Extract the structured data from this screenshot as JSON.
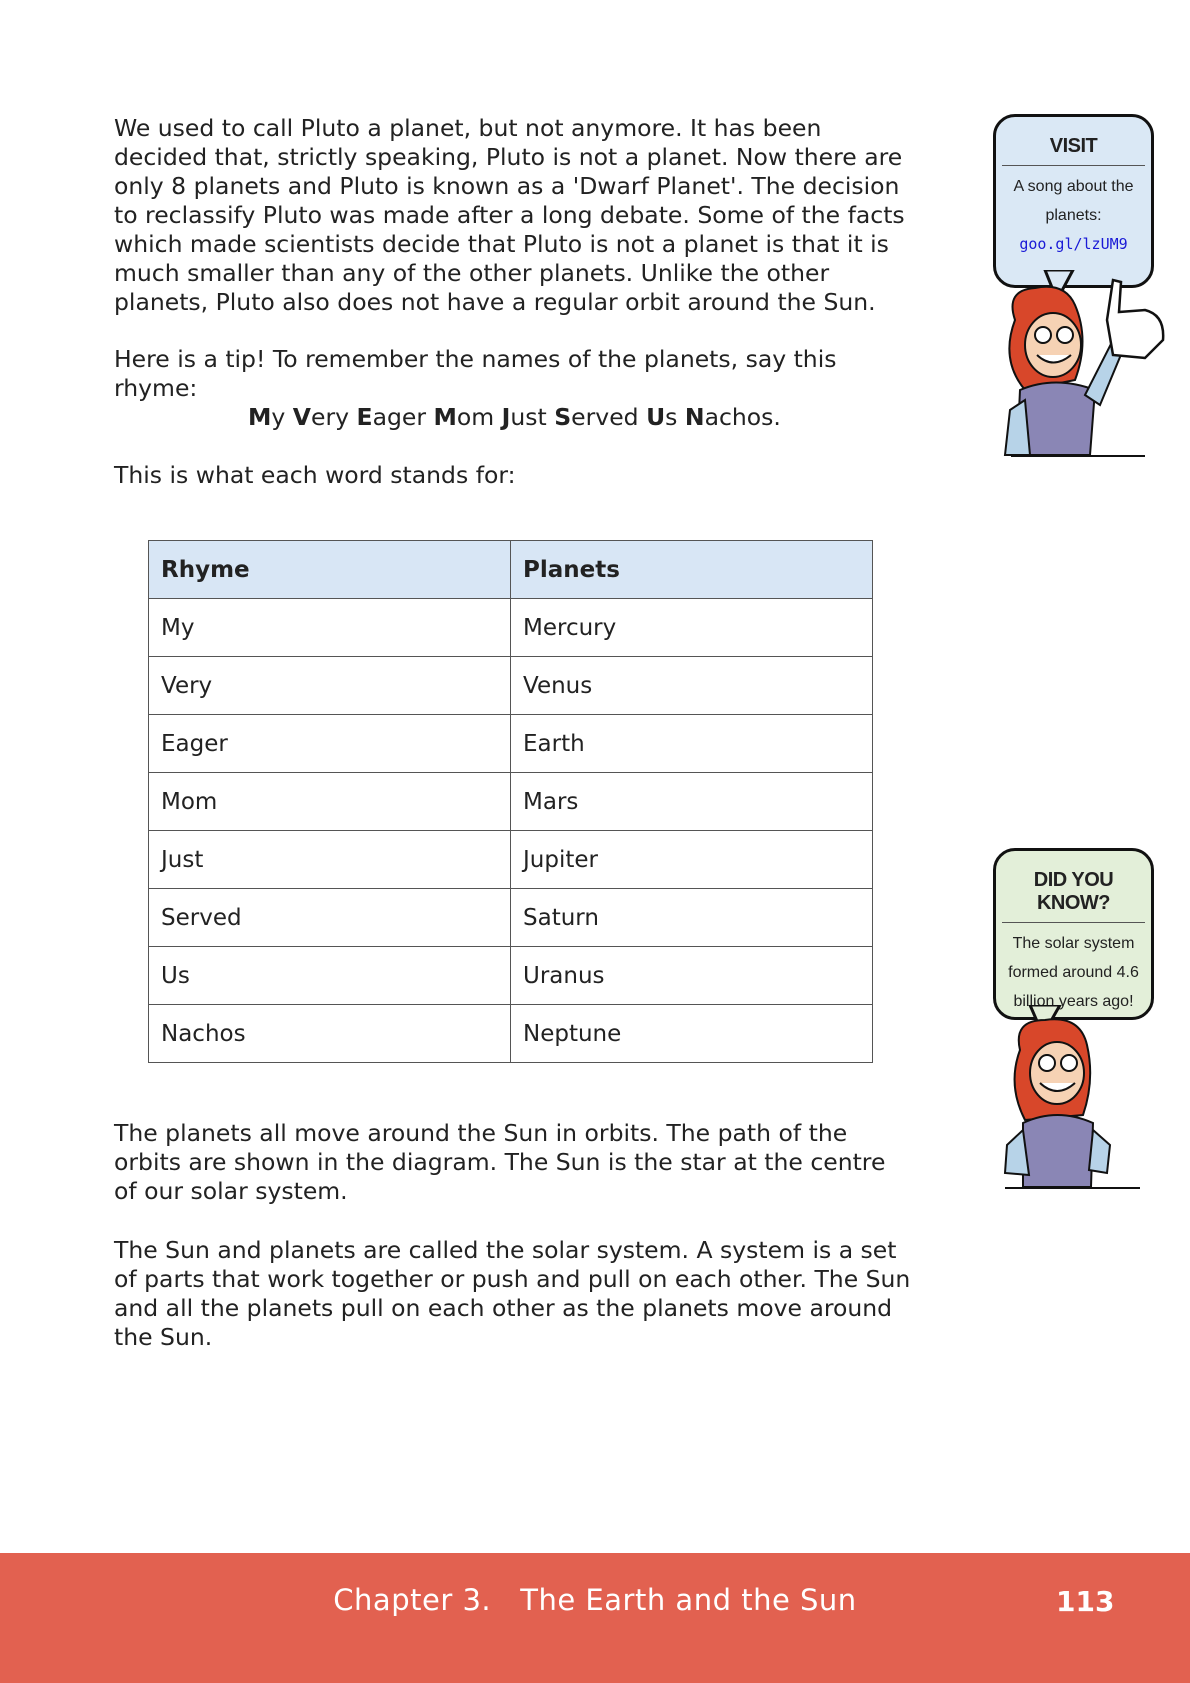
{
  "paragraphs": {
    "pluto": "We used to call Pluto a planet, but not anymore. It has been decided that, strictly speaking, Pluto is not a planet. Now there are only 8 planets and Pluto is known as a 'Dwarf Planet'. The decision to reclassify Pluto was made after a long debate. Some of the facts which made scientists decide that Pluto is not a planet is that it is much smaller than any of the other planets. Unlike the other planets, Pluto also does not have a regular orbit around the Sun.",
    "tip": "Here is a tip! To remember the names of the planets, say this rhyme:",
    "stands_for": "This is what each word stands for:",
    "orbits": "The planets all move around the Sun in orbits. The path of the orbits are shown in the diagram. The Sun is the star at the centre of our solar system.",
    "system": "The Sun and planets are called the solar system. A system is a set of parts that work together or push and pull on each other. The Sun and all the planets pull on each other as the planets move around the Sun."
  },
  "rhyme": {
    "words": [
      {
        "initial": "M",
        "rest": "y"
      },
      {
        "initial": "V",
        "rest": "ery"
      },
      {
        "initial": "E",
        "rest": "ager"
      },
      {
        "initial": "M",
        "rest": "om"
      },
      {
        "initial": "J",
        "rest": "ust"
      },
      {
        "initial": "S",
        "rest": "erved"
      },
      {
        "initial": "U",
        "rest": "s"
      },
      {
        "initial": "N",
        "rest": "achos."
      }
    ]
  },
  "table": {
    "headers": [
      "Rhyme",
      "Planets"
    ],
    "rows": [
      [
        "My",
        "Mercury"
      ],
      [
        "Very",
        "Venus"
      ],
      [
        "Eager",
        "Earth"
      ],
      [
        "Mom",
        "Mars"
      ],
      [
        "Just",
        "Jupiter"
      ],
      [
        "Served",
        "Saturn"
      ],
      [
        "Us",
        "Uranus"
      ],
      [
        "Nachos",
        "Neptune"
      ]
    ]
  },
  "visit_box": {
    "title": "VISIT",
    "text": "A song about the planets:",
    "link": "goo.gl/lzUM9"
  },
  "did_you_know_box": {
    "title": "DID YOU KNOW?",
    "text": "The solar system formed around 4.6 billion years ago!"
  },
  "footer": {
    "chapter": "Chapter 3.   The Earth and the Sun",
    "page_number": "113"
  },
  "colors": {
    "footer_bg": "#e26150",
    "table_header_bg": "#d8e6f5",
    "visit_bg": "#dae8f5",
    "did_you_know_bg": "#e3efd9",
    "link": "#1a1ad6"
  }
}
